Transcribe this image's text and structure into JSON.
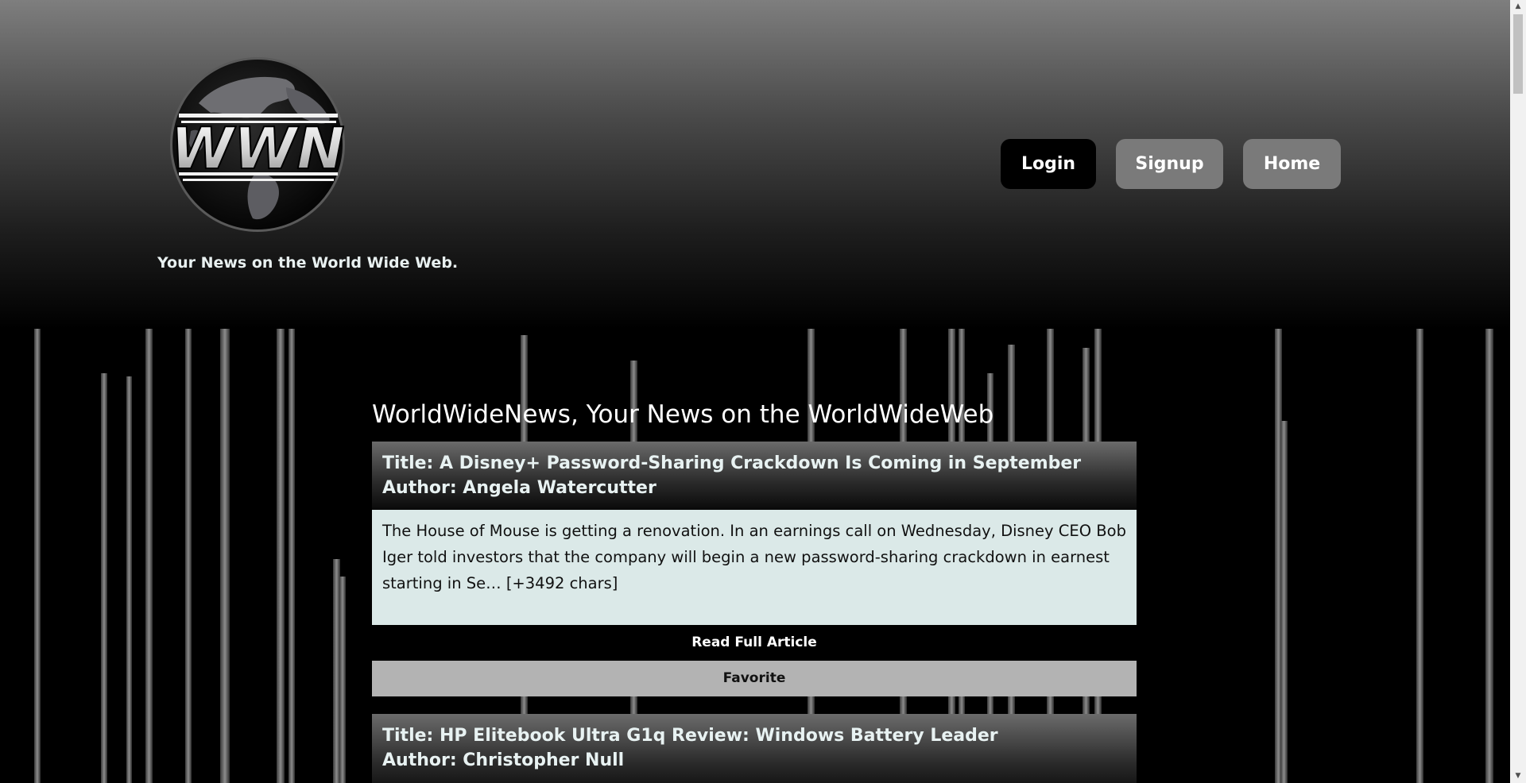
{
  "site": {
    "logo_text": "WWN",
    "tagline": "Your News on the World Wide Web."
  },
  "nav": {
    "login": "Login",
    "signup": "Signup",
    "home": "Home"
  },
  "main": {
    "title": "WorldWideNews, Your News on the WorldWideWeb"
  },
  "articles": [
    {
      "title": "Title: A Disney+ Password-Sharing Crackdown Is Coming in September",
      "author": "Author: Angela Watercutter",
      "description": "The House of Mouse is getting a renovation. In an earnings call on Wednesday, Disney CEO Bob Iger told investors that the company will begin a new password-sharing crackdown in earnest starting in Se… [+3492 chars]",
      "read_label": "Read Full Article",
      "favorite_label": "Favorite"
    },
    {
      "title": "Title: HP Elitebook Ultra G1q Review: Windows Battery Leader",
      "author": "Author: Christopher Null"
    }
  ],
  "colors": {
    "header_top": "#7e7e7e",
    "login_bg": "#000000",
    "secondary_btn_bg": "#7a7a7a",
    "article_body_bg": "#dbe9e8",
    "favorite_bg": "#b3b3b3"
  },
  "icons": {
    "scroll_up": "scroll-up-arrow-icon",
    "scroll_down": "scroll-down-arrow-icon"
  }
}
